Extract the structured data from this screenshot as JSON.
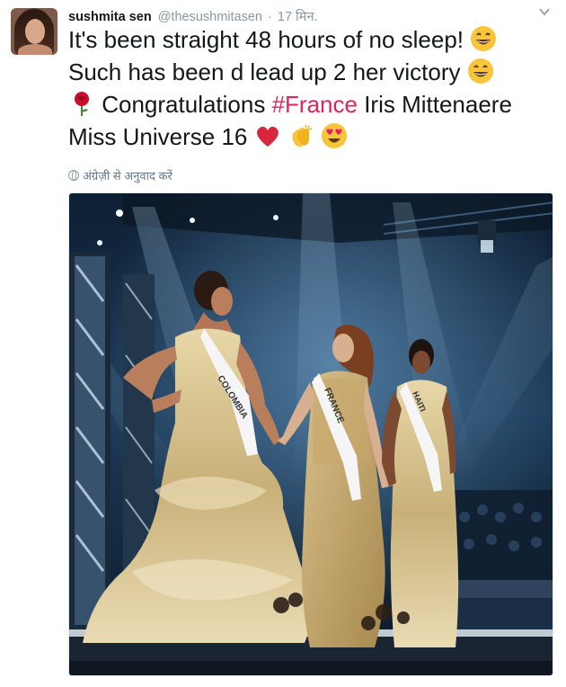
{
  "tweet": {
    "author_name": "sushmita sen",
    "author_handle": "@thesushmitasen",
    "separator": "·",
    "timestamp": "17 मिन.",
    "lines": [
      "It's been straight 48 hours of no sleep!",
      "Such has been d lead up 2 her victory",
      "Congratulations ",
      "Miss Universe 16"
    ],
    "hashtag": "#France",
    "line3_tail": " Iris Mittenaere",
    "translate_label": "अंग्रेज़ी से अनुवाद करें",
    "emojis": [
      "grinning-face",
      "grinning-face",
      "rose",
      "red-heart",
      "clapping-hands",
      "heart-eyes-face"
    ]
  },
  "photo": {
    "sashes": [
      "COLOMBIA",
      "FRANCE",
      "HAITI"
    ]
  },
  "colors": {
    "hashtag": "#e0245e",
    "muted": "#8899a6",
    "heart": "#d7263d",
    "emoji_yellow": "#f8c43a"
  }
}
